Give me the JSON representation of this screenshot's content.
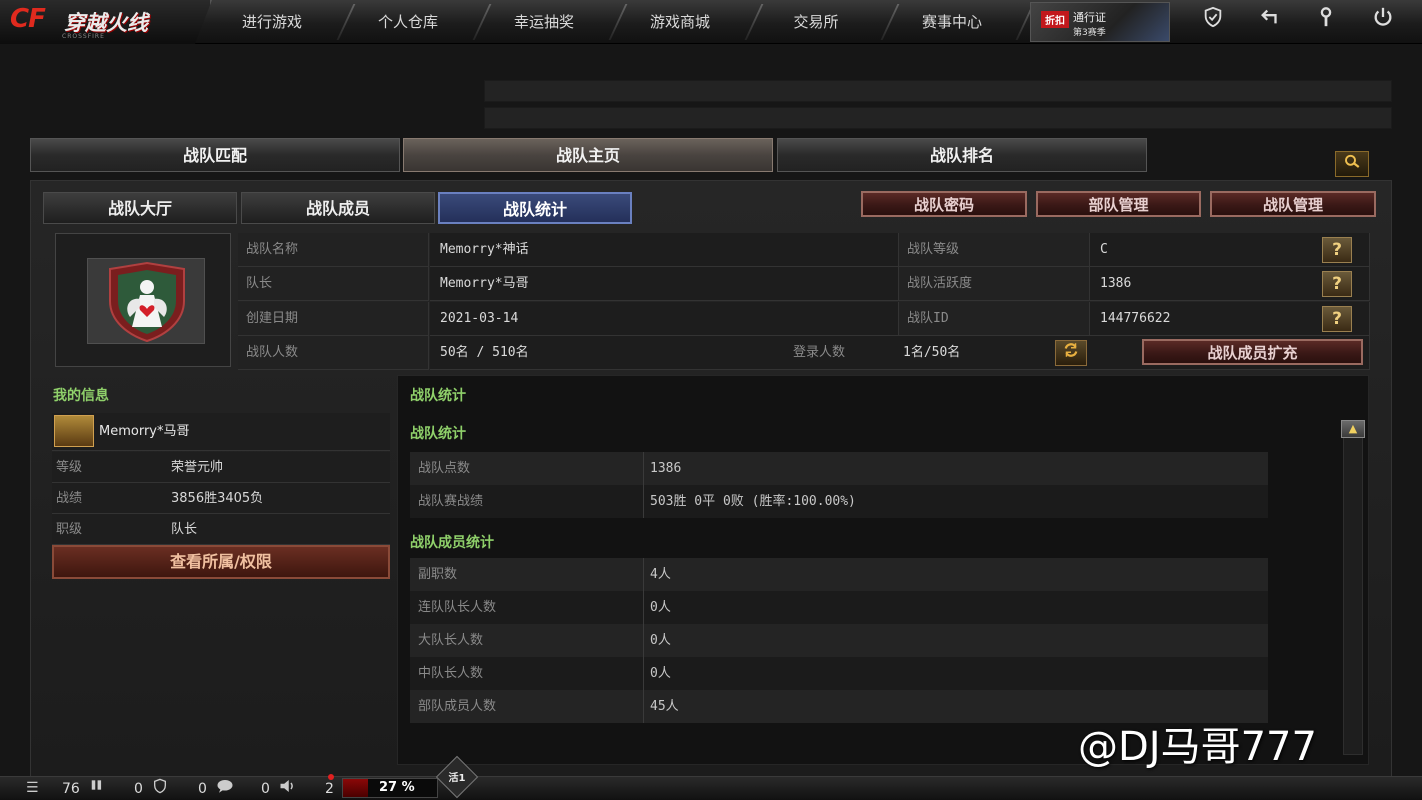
{
  "logo": {
    "cf": "CF",
    "name": "穿越火线",
    "sub": "CROSSFIRE"
  },
  "nav": {
    "items": [
      "进行游戏",
      "个人仓库",
      "幸运抽奖",
      "游戏商城",
      "交易所",
      "赛事中心"
    ],
    "promo": {
      "badge": "折扣",
      "line1": "通行证",
      "line2": "第3赛季"
    }
  },
  "main_tabs": [
    "战队匹配",
    "战队主页",
    "战队排名"
  ],
  "active_main_tab": "战队主页",
  "sub_tabs": [
    "战队大厅",
    "战队成员",
    "战队统计"
  ],
  "active_sub_tab": "战队统计",
  "actions": [
    "战队密码",
    "部队管理",
    "战队管理"
  ],
  "clan_info": {
    "name_label": "战队名称",
    "name": "Memorry*神话",
    "leader_label": "队长",
    "leader": "Memorry*马哥",
    "created_label": "创建日期",
    "created": "2021-03-14",
    "members_label": "战队人数",
    "members": "50名 / 510名",
    "login_label": "登录人数",
    "login": "1名/50名",
    "level_label": "战队等级",
    "level": "C",
    "activity_label": "战队活跃度",
    "activity": "1386",
    "id_label": "战队ID",
    "id": "144776622",
    "expand_button": "战队成员扩充"
  },
  "my_info": {
    "title": "我的信息",
    "player": "Memorry*马哥",
    "rank_label": "等级",
    "rank": "荣誉元帅",
    "record_label": "战绩",
    "record": "3856胜3405负",
    "position_label": "职级",
    "position": "队长",
    "view_button": "查看所属/权限"
  },
  "stats": {
    "panel_title": "战队统计",
    "section1_title": "战队统计",
    "section1": [
      {
        "label": "战队点数",
        "value": "1386"
      },
      {
        "label": "战队赛战绩",
        "value": "503胜 0平 0败 (胜率:100.00%)"
      }
    ],
    "section2_title": "战队成员统计",
    "section2": [
      {
        "label": "副职数",
        "value": "4人"
      },
      {
        "label": "连队队长人数",
        "value": "0人"
      },
      {
        "label": "大队长人数",
        "value": "0人"
      },
      {
        "label": "中队长人数",
        "value": "0人"
      },
      {
        "label": "部队成员人数",
        "value": "45人"
      }
    ]
  },
  "bottom_bar": {
    "count1": "76",
    "count2": "0",
    "count3": "0",
    "count4": "0",
    "count5": "2",
    "progress_text": "27 %",
    "progress": 0.27,
    "active_badge": "活1"
  },
  "watermark": "@DJ马哥777",
  "colors": {
    "accent_green": "#8fd06a",
    "active_tab_blue": "#3a4a7a",
    "danger_red": "#8a0808"
  }
}
